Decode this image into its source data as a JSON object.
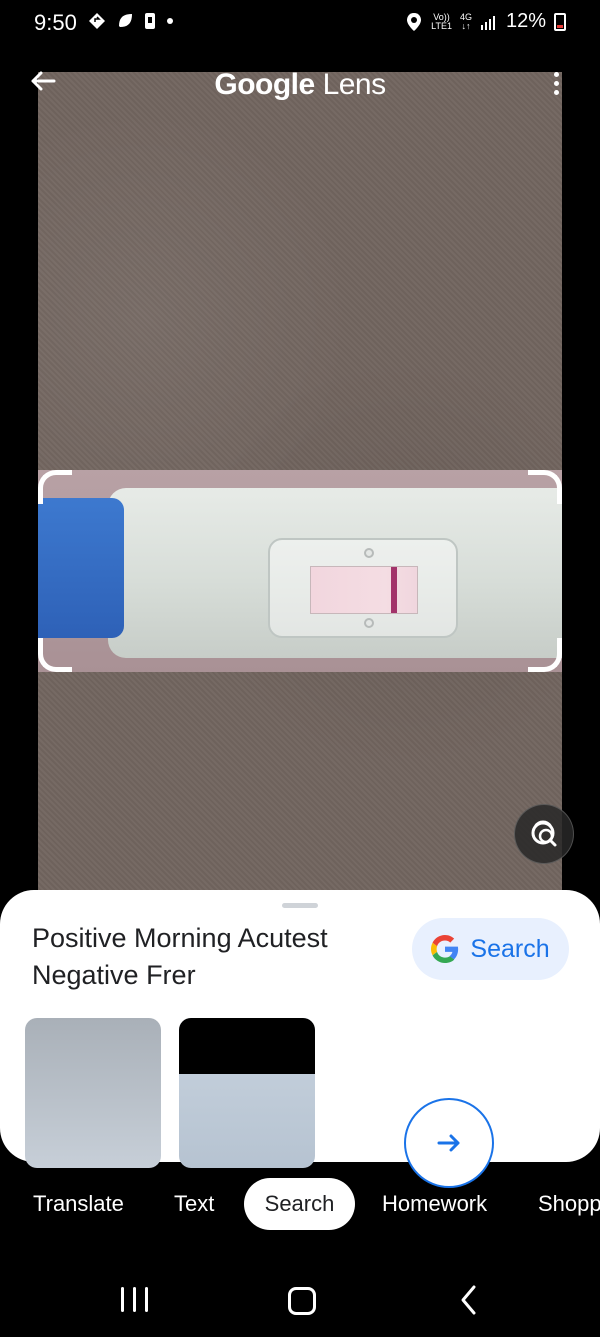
{
  "status_bar": {
    "time": "9:50",
    "left_icons": [
      "navigation-diamond-icon",
      "leaf-icon",
      "sim-card-icon",
      "dot-icon"
    ],
    "volte_label": "Vo))",
    "lte_label": "LTE1",
    "network_label": "4G",
    "battery_percent": "12%",
    "battery_color": "#e53935"
  },
  "header": {
    "brand": "Google",
    "product": "Lens"
  },
  "photo": {
    "background_color": "#72655f",
    "subject": "pregnancy test with faint line"
  },
  "sheet": {
    "title": "Positive Morning Acutest Negative Frer",
    "search_button_label": "Search",
    "thumbnails": [
      "thumbnail-1",
      "thumbnail-2"
    ]
  },
  "tabs": [
    {
      "label": "Translate",
      "active": false
    },
    {
      "label": "Text",
      "active": false
    },
    {
      "label": "Search",
      "active": true
    },
    {
      "label": "Homework",
      "active": false
    },
    {
      "label": "Shopp",
      "active": false
    }
  ],
  "system_nav": {
    "buttons": [
      "recent-apps",
      "home",
      "back"
    ]
  },
  "colors": {
    "accent": "#1a73e8",
    "search_chip_bg": "#e8f0fe",
    "test_cap_blue": "#2e61b7",
    "result_line": "#a2336a"
  }
}
